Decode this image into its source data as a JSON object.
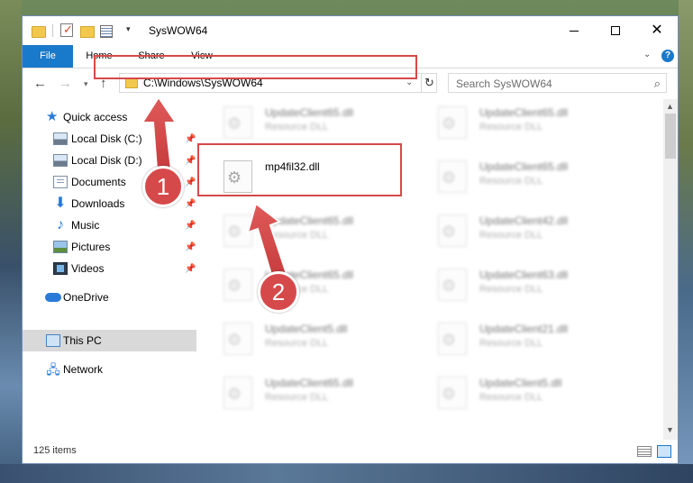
{
  "window": {
    "title": "SysWOW64"
  },
  "ribbon": {
    "tabs": [
      {
        "label": "File"
      },
      {
        "label": "Home"
      },
      {
        "label": "Share"
      },
      {
        "label": "View"
      }
    ]
  },
  "navbar": {
    "address": "C:\\Windows\\SysWOW64",
    "search_placeholder": "Search SysWOW64"
  },
  "sidebar": {
    "items": [
      {
        "label": "Quick access",
        "icon": "star-icon"
      },
      {
        "label": "Local Disk (C:)",
        "icon": "drive-icon",
        "pinned": true
      },
      {
        "label": "Local Disk (D:)",
        "icon": "drive-icon",
        "pinned": true
      },
      {
        "label": "Documents",
        "icon": "documents-icon",
        "pinned": true
      },
      {
        "label": "Downloads",
        "icon": "download-arrow-icon",
        "pinned": true
      },
      {
        "label": "Music",
        "icon": "music-note-icon",
        "pinned": true
      },
      {
        "label": "Pictures",
        "icon": "pictures-icon",
        "pinned": true
      },
      {
        "label": "Videos",
        "icon": "videos-icon",
        "pinned": true
      },
      {
        "label": "OneDrive",
        "icon": "cloud-icon"
      },
      {
        "label": "This PC",
        "icon": "computer-icon",
        "selected": true
      },
      {
        "label": "Network",
        "icon": "network-icon"
      }
    ]
  },
  "files": {
    "highlighted": {
      "name": "mp4fil32.dll",
      "type": ""
    },
    "blurred": [
      {
        "name": "UpdateClient65.dll",
        "type": "Resource DLL"
      },
      {
        "name": "UpdateClient65.dll",
        "type": "Resource DLL"
      },
      {
        "name": "UpdateClient65.dll",
        "type": "Resource DLL"
      },
      {
        "name": "UpdateClient65.dll",
        "type": "Resource DLL"
      },
      {
        "name": "UpdateClient42.dll",
        "type": "Resource DLL"
      },
      {
        "name": "UpdateClient65.dll",
        "type": "Resource DLL"
      },
      {
        "name": "UpdateClient63.dll",
        "type": "Resource DLL"
      },
      {
        "name": "UpdateClient5.dll",
        "type": "Resource DLL"
      },
      {
        "name": "UpdateClient21.dll",
        "type": "Resource DLL"
      },
      {
        "name": "UpdateClient65.dll",
        "type": "Resource DLL"
      },
      {
        "name": "UpdateClient5.dll",
        "type": "Resource DLL"
      }
    ]
  },
  "status": {
    "item_count": "125 items"
  },
  "annotations": {
    "step1": "1",
    "step2": "2"
  },
  "colors": {
    "accent": "#1979ca",
    "highlight_red": "#d6494a",
    "selected_bg": "#d9d9d9"
  }
}
